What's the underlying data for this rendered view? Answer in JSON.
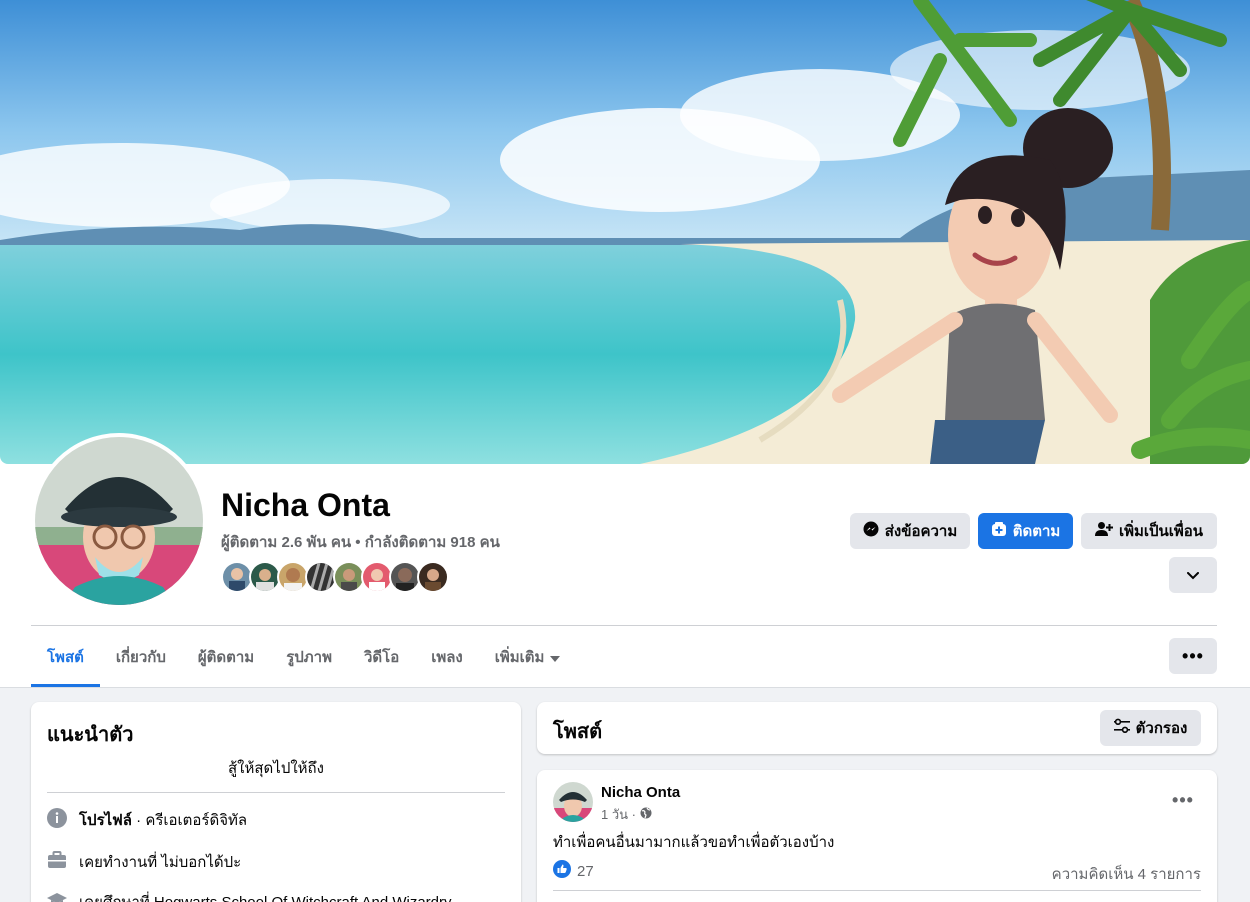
{
  "profile": {
    "name": "Nicha Onta",
    "stats": "ผู้ติดตาม 2.6 พัน คน • กำลังติดตาม 918 คน"
  },
  "actions": {
    "message_label": "ส่งข้อความ",
    "follow_label": "ติดตาม",
    "add_friend_label": "เพิ่มเป็นเพื่อน"
  },
  "tabs": [
    {
      "label": "โพสต์"
    },
    {
      "label": "เกี่ยวกับ"
    },
    {
      "label": "ผู้ติดตาม"
    },
    {
      "label": "รูปภาพ"
    },
    {
      "label": "วิดีโอ"
    },
    {
      "label": "เพลง"
    },
    {
      "label": "เพิ่มเติม"
    }
  ],
  "intro": {
    "title": "แนะนำตัว",
    "bio": "สู้ให้สุดไปให้ถึง",
    "profile_label": "โปรไฟล์",
    "profile_value": " · ครีเอเตอร์ดิจิทัล",
    "work": "เคยทำงานที่ ไม่บอกได้ปะ",
    "education": "เคยศึกษาที่ Hogwarts School Of Witchcraft And Wizardry"
  },
  "posts_header": {
    "title": "โพสต์",
    "filter_label": "ตัวกรอง"
  },
  "post": {
    "author": "Nicha Onta",
    "time": "1 วัน ·",
    "text": "ทำเพื่อคนอื่นมามากแล้วขอทำเพื่อตัวเองบ้าง",
    "likes": "27",
    "comments": "ความคิดเห็น 4 รายการ"
  },
  "colors": {
    "accent": "#1b74e4",
    "secondary_text": "#65676b",
    "button_grey": "#e4e6eb"
  }
}
